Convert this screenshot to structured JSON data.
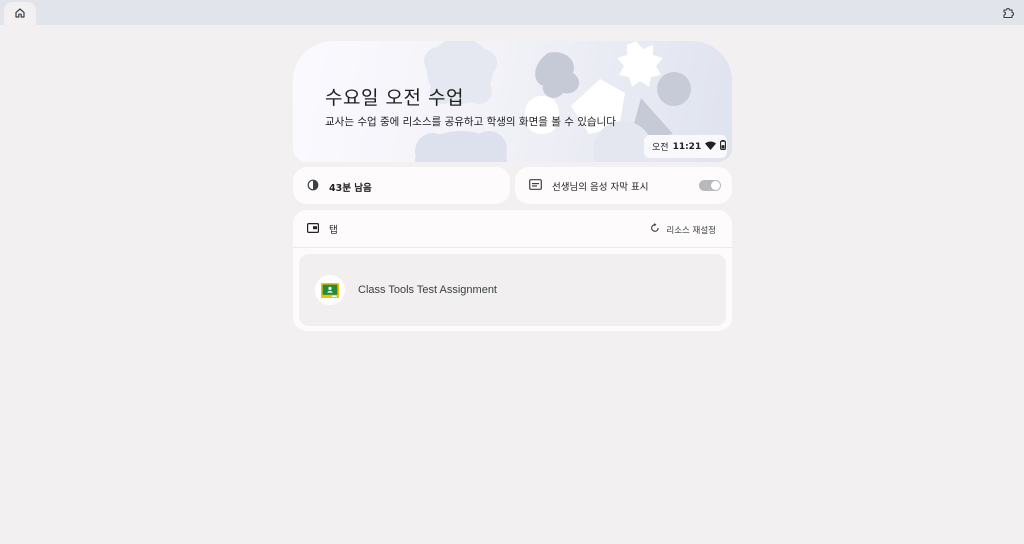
{
  "hero": {
    "title": "수요일 오전 수업",
    "subtitle": "교사는 수업 중에 리소스를 공유하고 학생의 화면을 볼 수 있습니다"
  },
  "status": {
    "period": "오전",
    "time": "11:21"
  },
  "time_card": {
    "label": "43분 남음"
  },
  "caption_card": {
    "label": "선생님의 음성 자막 표시",
    "enabled": false
  },
  "tabs_card": {
    "title": "탭",
    "reset_label": "리소스 재설정",
    "items": [
      {
        "title": "Class Tools Test Assignment",
        "icon": "google-classroom-icon"
      }
    ]
  },
  "colors": {
    "page_bg": "#f2f0f1",
    "card_bg": "#fdfbfc",
    "topbar_bg": "#e2e4ec",
    "classroom_green": "#1e8e3e",
    "classroom_yellow": "#fbbc04"
  }
}
